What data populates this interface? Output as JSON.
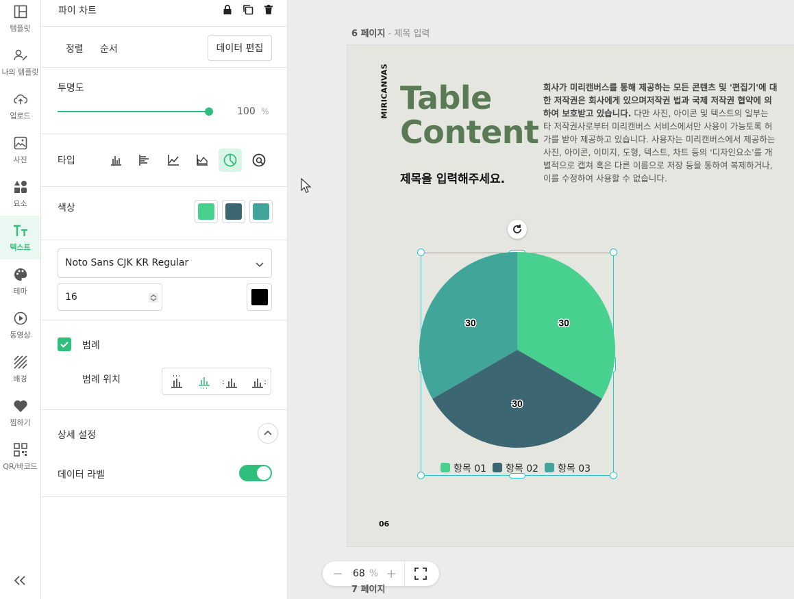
{
  "sidebar": {
    "items": [
      {
        "label": "템플릿",
        "icon": "layout-icon"
      },
      {
        "label": "나의 템플릿",
        "icon": "user-edit-icon"
      },
      {
        "label": "업로드",
        "icon": "cloud-upload-icon"
      },
      {
        "label": "사진",
        "icon": "image-icon"
      },
      {
        "label": "요소",
        "icon": "shapes-icon"
      },
      {
        "label": "텍스트",
        "icon": "text-icon",
        "active": true
      },
      {
        "label": "테마",
        "icon": "palette-icon"
      },
      {
        "label": "동영상",
        "icon": "play-icon"
      },
      {
        "label": "배경",
        "icon": "background-icon"
      },
      {
        "label": "찜하기",
        "icon": "heart-icon"
      },
      {
        "label": "QR/바코드",
        "icon": "qr-icon"
      }
    ]
  },
  "panel": {
    "title": "파이 차트",
    "align_label": "정렬",
    "order_label": "순서",
    "edit_data_label": "데이터 편집",
    "opacity_label": "투명도",
    "opacity_value": "100",
    "opacity_unit": "%",
    "opacity_fraction": 1.0,
    "type_label": "타입",
    "color_label": "색상",
    "colors": [
      "#48d08f",
      "#3b6672",
      "#41a59a"
    ],
    "font_name": "Noto Sans CJK KR Regular",
    "font_size": "16",
    "font_color": "#000000",
    "legend_label": "범례",
    "legend_checked": true,
    "legend_position_label": "범례 위치",
    "advanced_label": "상세 설정",
    "data_label_label": "데이터 라벨",
    "data_label_on": true
  },
  "canvas": {
    "page_number": "6 페이지",
    "page_title": " - 제목 입력",
    "next_page_label": "7 페이지",
    "brand_vertical": "MIRICANVAS",
    "heading_line1": "Table",
    "heading_line2": "Content",
    "subtitle": "제목을 입력해주세요.",
    "body_bold": "회사가 미리캔버스를 통해 제공하는 모든 콘텐츠 및 '편집기'에 대한 저작권은 회사에게 있으며저작권 법과 국제 저작권 협약에 의하여 보호받고 있습니다.",
    "body_regular": " 다만 사진, 아이콘 및 텍스트의 일부는 타 저작권사로부터 미리캔버스 서비스에서만 사용이 가능토록 허가를 받아 제공하고 있습니다. 사용자는 미리캔버스에서 제공하는 사진, 아이콘, 이미지, 도형, 텍스트, 차트 등의 '디자인요소'를 개별적으로 캡쳐 혹은 다른 이름으로 저장 등을 통하여 복제하거나, 이를 수정하여 사용할 수 없습니다.",
    "page_footer": "06",
    "heading_color": "#5a7a55"
  },
  "chart_data": {
    "type": "pie",
    "categories": [
      "항목 01",
      "항목 02",
      "항목 03"
    ],
    "values": [
      30,
      30,
      30
    ],
    "colors": [
      "#48d08f",
      "#3b6672",
      "#41a59a"
    ],
    "data_labels": true,
    "legend": "bottom"
  },
  "zoom": {
    "minus": "−",
    "value": "68",
    "unit": "%",
    "plus": "+"
  }
}
